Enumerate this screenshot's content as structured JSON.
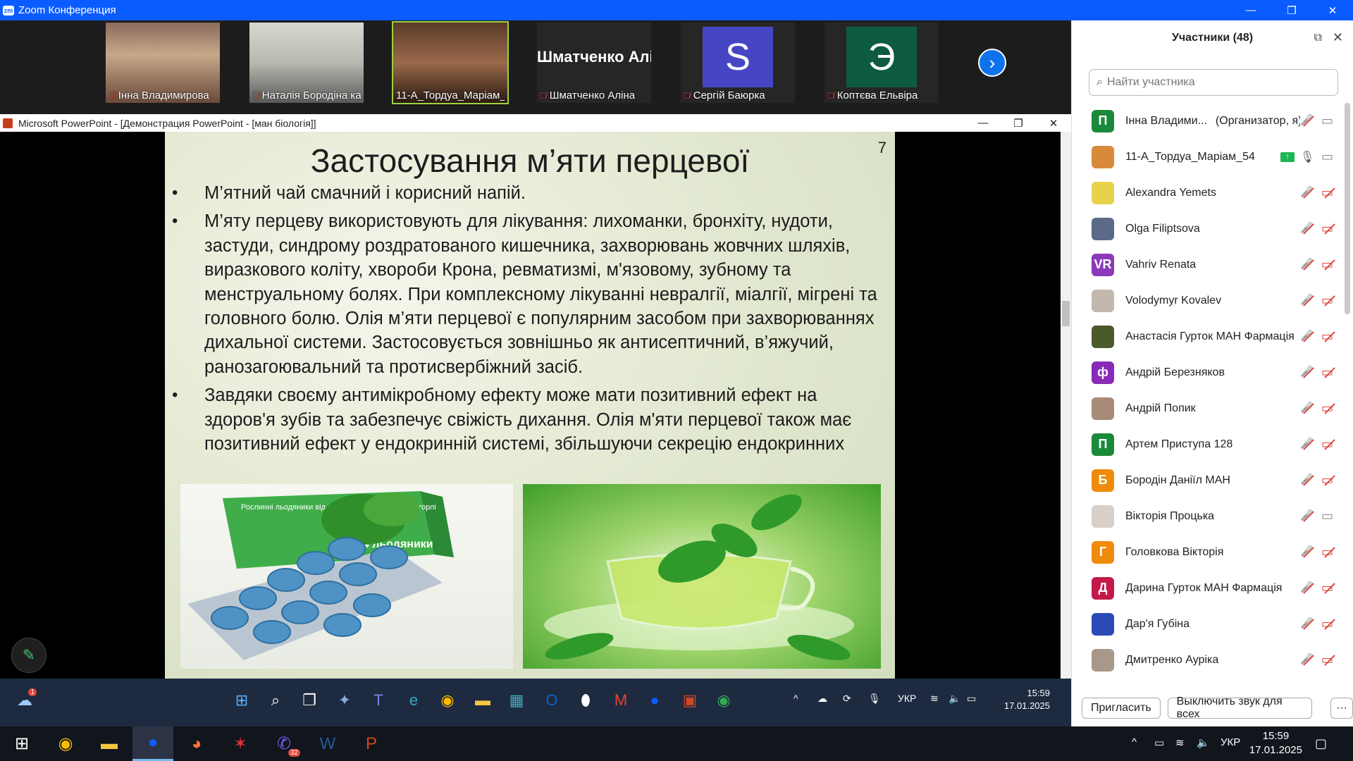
{
  "zoom": {
    "window_title": "Zoom Конференция",
    "window_buttons": [
      "—",
      "❐",
      "✕"
    ]
  },
  "video_strip": {
    "tiles": [
      {
        "name": "Інна Владимирова"
      },
      {
        "name": "Наталія Бородіна каф..."
      },
      {
        "name": "11-А_Тордуа_Маріам_54"
      },
      {
        "name": "Шматченко Аліна",
        "big": "Шматченко Алі..."
      },
      {
        "name": "Сергій Баюрка",
        "letter": "S",
        "color": "#4646c4"
      },
      {
        "name": "Коптєва Ельвіра",
        "letter": "Э",
        "color": "#0c5b42"
      }
    ]
  },
  "powerpoint": {
    "window_title": "Microsoft PowerPoint - [Демонстрация PowerPoint - [ман біологія]]",
    "slide": {
      "title": "Застосування м’яти перцевої",
      "number": "7",
      "bullets": [
        "М’ятний чай смачний і корисний напій.",
        "М’яту перцеву використовують для лікування: лихоманки, бронхіту, нудоти, застуди, синдрому роздратованого кишечника, захворювань жовчних шляхів, виразкового коліту, хвороби Крона, ревматизмі, м'язовому, зубному та менструальному болях. При комплексному лікуванні невралгії, міалгії, мігрені та головного болю. Олія м’яти перцевої є популярним засобом при захворюваннях дихальної системи. Застосовується зовнішньо як антисептичний, в’яжучий, ранозагоювальний та протисвербіжний засіб.",
        "Завдяки своєму антимікробному ефекту може мати позитивний ефект на здоров'я зубів та забезпечує свіжість дихання. Олія м'яти перцевої також має позитивний ефект у ендокринній системі, збільшуючи секрецію ендокринних"
      ],
      "lozenge_box_text": "Рослинні льодяники від кашлю та подразнення у горлі",
      "lozenge_count": "24 льодяники"
    }
  },
  "participants": {
    "header": "Участники (48)",
    "search_placeholder": "Найти участника",
    "list": [
      {
        "name": "Інна Владими...",
        "role": "(Организатор, я)",
        "initial": "П",
        "color": "#1a8a3a",
        "mic": "off",
        "cam": "on"
      },
      {
        "name": "11-А_Тордуа_Маріам_54",
        "initial": "",
        "color": "#d88a3a",
        "mic": "on",
        "cam": "on",
        "share": true
      },
      {
        "name": "Alexandra Yemets",
        "initial": "",
        "color": "#e8d24a",
        "mic": "off",
        "cam": "off"
      },
      {
        "name": "Olga Filiptsova",
        "initial": "",
        "color": "#5a6a88",
        "mic": "off",
        "cam": "off"
      },
      {
        "name": "Vahriv Renata",
        "initial": "VR",
        "color": "#8a3ab8",
        "mic": "off",
        "cam": "off"
      },
      {
        "name": "Volodymyr Kovalev",
        "initial": "",
        "color": "#c2b8ae",
        "mic": "off",
        "cam": "off"
      },
      {
        "name": "Анастасія Гурток МАН Фармація",
        "initial": "",
        "color": "#4a5a2a",
        "mic": "off",
        "cam": "off"
      },
      {
        "name": "Андрій Березняков",
        "initial": "ф",
        "color": "#8a2ab8",
        "mic": "off",
        "cam": "off"
      },
      {
        "name": "Андрій Попик",
        "initial": "",
        "color": "#a88a78",
        "mic": "off",
        "cam": "off"
      },
      {
        "name": "Артем Приступа 128",
        "initial": "П",
        "color": "#1a8a3a",
        "mic": "off",
        "cam": "off"
      },
      {
        "name": "Бородін Даніїл МАН",
        "initial": "Б",
        "color": "#f08a0a",
        "mic": "off",
        "cam": "off"
      },
      {
        "name": "Вікторія Процька",
        "initial": "",
        "color": "#d8d0c8",
        "mic": "off",
        "cam": "on"
      },
      {
        "name": "Головкова Вікторія",
        "initial": "Г",
        "color": "#f08a0a",
        "mic": "off",
        "cam": "off"
      },
      {
        "name": "Дарина Гурток МАН Фармація",
        "initial": "Д",
        "color": "#c41a4a",
        "mic": "off",
        "cam": "off"
      },
      {
        "name": "Дар'я Губіна",
        "initial": "",
        "color": "#2a4ab8",
        "mic": "off",
        "cam": "off"
      },
      {
        "name": "Дмитренко Ауріка",
        "initial": "",
        "color": "#a8988a",
        "mic": "off",
        "cam": "off"
      }
    ],
    "invite_label": "Пригласить",
    "mute_all_label": "Выключить звук для всех",
    "more_label": "···"
  },
  "inner_taskbar": {
    "lang": "УКР",
    "time": "15:59",
    "date": "17.01.2025",
    "weather_badge": "1"
  },
  "taskbar": {
    "lang": "УКР",
    "time": "15:59",
    "date": "17.01.2025",
    "viber_badge": "32"
  },
  "colors": {
    "zoom_blue": "#0b5cff",
    "mic_off_red": "#e0453a",
    "active_speaker": "#9ed13c"
  }
}
